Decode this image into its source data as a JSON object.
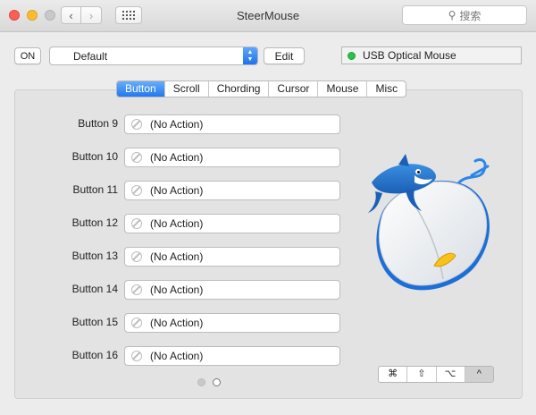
{
  "window": {
    "title": "SteerMouse"
  },
  "search": {
    "placeholder": "搜索"
  },
  "toolbar": {
    "on_label": "ON",
    "preset_value": "Default",
    "edit_label": "Edit",
    "device_name": "USB Optical Mouse",
    "device_status_color": "#29c24a"
  },
  "tabs": [
    {
      "label": "Button",
      "active": true
    },
    {
      "label": "Scroll"
    },
    {
      "label": "Chording"
    },
    {
      "label": "Cursor"
    },
    {
      "label": "Mouse"
    },
    {
      "label": "Misc"
    }
  ],
  "buttons": [
    {
      "label": "Button 9",
      "action": "(No Action)"
    },
    {
      "label": "Button 10",
      "action": "(No Action)"
    },
    {
      "label": "Button 11",
      "action": "(No Action)"
    },
    {
      "label": "Button 12",
      "action": "(No Action)"
    },
    {
      "label": "Button 13",
      "action": "(No Action)"
    },
    {
      "label": "Button 14",
      "action": "(No Action)"
    },
    {
      "label": "Button 15",
      "action": "(No Action)"
    },
    {
      "label": "Button 16",
      "action": "(No Action)"
    }
  ],
  "pager": {
    "current_page": 2,
    "total_pages": 2
  },
  "modifiers": [
    {
      "label": "⌘"
    },
    {
      "label": "⇧"
    },
    {
      "label": "⌥"
    },
    {
      "label": "^",
      "selected": true
    }
  ],
  "colors": {
    "accent": "#2278f0"
  },
  "icons": {
    "search": "magnifier-icon",
    "no_action": "prohibited-icon",
    "mascot": "shark-on-mouse-icon"
  }
}
